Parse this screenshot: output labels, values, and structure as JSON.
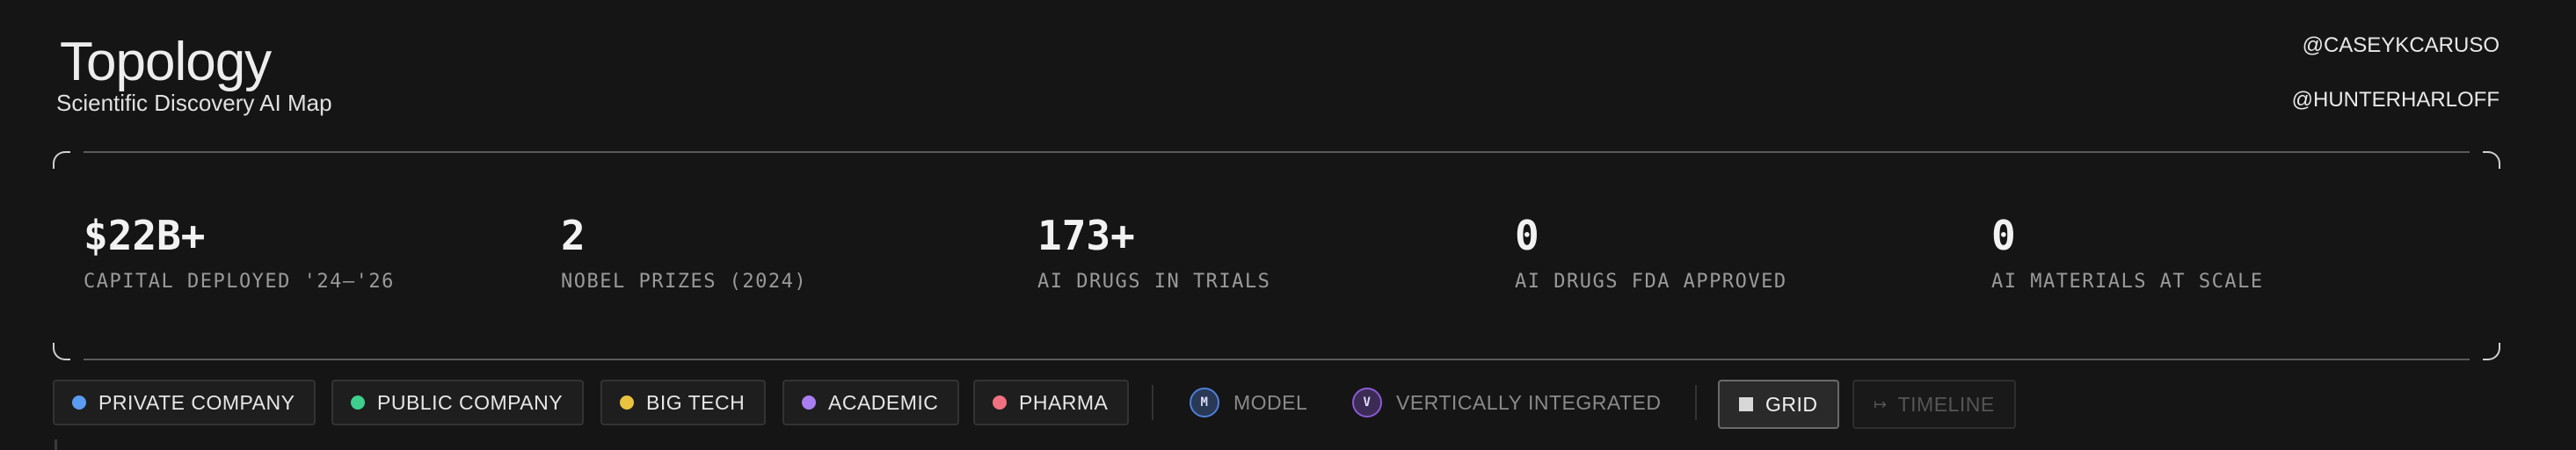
{
  "brand": {
    "title": "Topology",
    "subtitle": "Scientific Discovery AI Map"
  },
  "handles": [
    "@CASEYKCARUSO",
    "@HUNTERHARLOFF"
  ],
  "stats": [
    {
      "value": "$22B+",
      "label": "CAPITAL DEPLOYED '24–'26"
    },
    {
      "value": "2",
      "label": "NOBEL PRIZES (2024)"
    },
    {
      "value": "173+",
      "label": "AI DRUGS IN TRIALS"
    },
    {
      "value": "0",
      "label": "AI DRUGS FDA APPROVED"
    },
    {
      "value": "0",
      "label": "AI MATERIALS AT SCALE"
    }
  ],
  "filters": {
    "categories": [
      {
        "label": "PRIVATE COMPANY",
        "color": "#5b9cf0"
      },
      {
        "label": "PUBLIC COMPANY",
        "color": "#3ecf8e"
      },
      {
        "label": "BIG TECH",
        "color": "#e9c33f"
      },
      {
        "label": "ACADEMIC",
        "color": "#a97ef0"
      },
      {
        "label": "PHARMA",
        "color": "#f07280"
      }
    ],
    "types": [
      {
        "badge": "M",
        "label": "MODEL",
        "color": "#4f7fd6"
      },
      {
        "badge": "V",
        "label": "VERTICALLY INTEGRATED",
        "color": "#8a5ad6"
      }
    ],
    "views": [
      {
        "label": "GRID",
        "active": true,
        "icon": "grid-icon"
      },
      {
        "label": "TIMELINE",
        "active": false,
        "icon": "timeline-icon",
        "glyph": "↦"
      }
    ]
  }
}
